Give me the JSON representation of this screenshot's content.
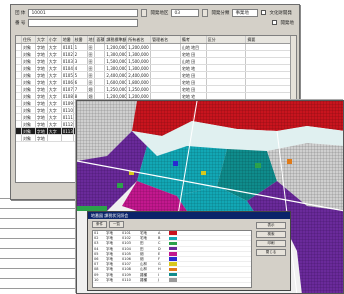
{
  "register_form": {
    "fields": [
      {
        "label": "団 体",
        "value": "10001",
        "label2": "開発地区",
        "value2": "03",
        "label3": "開発分類",
        "value3": "事業地",
        "check_label": "文化財開発"
      },
      {
        "label": "番 号",
        "value": "",
        "label2": "",
        "value2": "",
        "label3": "",
        "value3": "",
        "check_label": "開発地"
      }
    ],
    "columns": [
      "",
      "住所",
      "大字",
      "小字",
      "地番",
      "枝番",
      "地目",
      "面積",
      "課税標準額",
      "所有者名",
      "管理者名",
      "備考",
      "区分",
      "摘要"
    ],
    "rows": [
      [
        "",
        "対象",
        "字地",
        "大字",
        "0101",
        "1",
        "田",
        "",
        "1,200,000",
        "1,200,000",
        "",
        "山地 地目",
        "",
        ""
      ],
      [
        "",
        "対象",
        "字地",
        "大字",
        "0102",
        "2",
        "田",
        "",
        "1,300,000",
        "1,300,000",
        "",
        "宅地 田",
        "",
        ""
      ],
      [
        "",
        "対象",
        "字地",
        "大字",
        "0103",
        "3",
        "田",
        "",
        "1,500,000",
        "1,500,000",
        "",
        "山地 田",
        "",
        ""
      ],
      [
        "",
        "対象",
        "字地",
        "大字",
        "0104",
        "4",
        "田",
        "",
        "1,300,000",
        "1,300,000",
        "",
        "宅地 地",
        "",
        ""
      ],
      [
        "",
        "対象",
        "字地",
        "大字",
        "0105",
        "5",
        "田",
        "",
        "2,400,000",
        "2,400,000",
        "",
        "宅地 田",
        "",
        ""
      ],
      [
        "",
        "対象",
        "字地",
        "大字",
        "0106",
        "6",
        "田",
        "",
        "1,600,000",
        "1,800,000",
        "",
        "宅地 田",
        "",
        ""
      ],
      [
        "",
        "対象",
        "字地",
        "大字",
        "0107",
        "7",
        "畑",
        "",
        "1,250,000",
        "1,250,000",
        "",
        "宅地 田",
        "",
        ""
      ],
      [
        "",
        "対象",
        "字地",
        "大字",
        "0108",
        "8",
        "畑",
        "",
        "1,200,000",
        "1,200,000",
        "",
        "宅地 宅",
        "",
        ""
      ],
      [
        "",
        "対象",
        "字地",
        "大字",
        "0109",
        "9",
        "畑",
        "",
        "1,200,000",
        "1,300,000",
        "",
        "宅地 宅",
        "",
        ""
      ],
      [
        "",
        "対象",
        "字地",
        "大字",
        "0110",
        "10",
        "畑",
        "",
        "1,300,000",
        "1,300,000",
        "",
        "宅地 田",
        "",
        ""
      ],
      [
        "",
        "対象",
        "字地",
        "大字",
        "0111",
        "11",
        "宅",
        "",
        "",
        "",
        "",
        "",
        "",
        ""
      ],
      [
        "",
        "対象",
        "字地",
        "大字",
        "0112",
        "12",
        "宅",
        "",
        "",
        "",
        "",
        "",
        "",
        ""
      ],
      [
        "",
        "対象",
        "字地",
        "大字",
        "0113",
        "",
        "",
        "",
        "",
        "",
        "",
        "",
        "",
        ""
      ],
      [
        "",
        "対象",
        "字地",
        "",
        "",
        "",
        "",
        "",
        "",
        "",
        "",
        "",
        "",
        ""
      ]
    ],
    "selected_row": 12
  },
  "map_window": {
    "colors": {
      "bg": "#e8e8e8",
      "red": "#c8141e",
      "cyan": "#12a7b5",
      "teal": "#0f8c8c",
      "purple": "#6a2a9a",
      "magenta": "#c2188e",
      "blue": "#2a2ad0",
      "green": "#2ca24a",
      "yellow": "#d8c81c",
      "orange": "#e07a18",
      "gray": "#9a9a9a"
    }
  },
  "dialog": {
    "title": "地番図 課税状況照会",
    "tabs": [
      "条件",
      "一覧"
    ],
    "rows": [
      [
        "01",
        "字地",
        "0101",
        "宅地",
        "A"
      ],
      [
        "02",
        "字地",
        "0102",
        "宅地",
        "B"
      ],
      [
        "03",
        "字地",
        "0103",
        "田",
        "C"
      ],
      [
        "04",
        "字地",
        "0104",
        "田",
        "D"
      ],
      [
        "05",
        "字地",
        "0105",
        "畑",
        "E"
      ],
      [
        "06",
        "字地",
        "0106",
        "畑",
        "F"
      ],
      [
        "07",
        "字地",
        "0107",
        "山林",
        "G"
      ],
      [
        "08",
        "字地",
        "0108",
        "山林",
        "H"
      ],
      [
        "09",
        "字地",
        "0109",
        "雑種",
        "I"
      ],
      [
        "10",
        "字地",
        "0110",
        "雑種",
        "J"
      ]
    ],
    "swatches": [
      "#c8141e",
      "#12a7b5",
      "#2ca24a",
      "#6a2a9a",
      "#c2188e",
      "#2a2ad0",
      "#d8c81c",
      "#e07a18",
      "#0f8c8c",
      "#9a9a9a"
    ],
    "buttons": [
      "表示",
      "検索",
      "印刷",
      "閉じる"
    ]
  }
}
